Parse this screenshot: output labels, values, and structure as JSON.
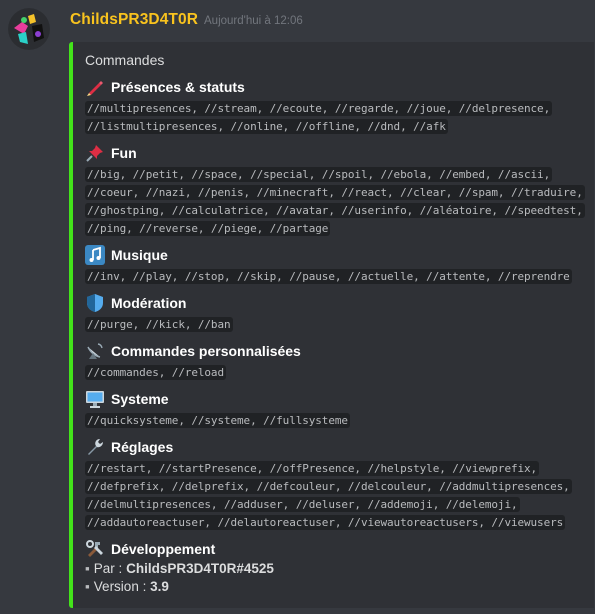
{
  "author": {
    "username": "ChildsPR3D4T0R",
    "timestamp": "Aujourd'hui à 12:06"
  },
  "embed": {
    "accent_color": "#43e31a",
    "title": "Commandes",
    "fields": [
      {
        "icon": "crayon-icon",
        "name": "Présences & statuts",
        "lines": [
          "//multipresences, //stream, //ecoute, //regarde, //joue, //delpresence,",
          "//listmultipresences, //online, //offline, //dnd, //afk"
        ]
      },
      {
        "icon": "pushpin-icon",
        "name": "Fun",
        "lines": [
          "//big, //petit, //space, //special, //spoil, //ebola, //embed, //ascii,",
          "//coeur, //nazi, //penis, //minecraft, //react, //clear, //spam, //traduire,",
          "//ghostping, //calculatrice, //avatar, //userinfo, //aléatoire, //speedtest,",
          "//ping, //reverse, //piege, //partage"
        ]
      },
      {
        "icon": "musical-notes-icon",
        "name": "Musique",
        "lines": [
          "//inv, //play, //stop, //skip, //pause, //actuelle, //attente, //reprendre"
        ]
      },
      {
        "icon": "shield-icon",
        "name": "Modération",
        "lines": [
          "//purge, //kick, //ban"
        ]
      },
      {
        "icon": "satellite-dish-icon",
        "name": "Commandes personnalisées",
        "lines": [
          "//commandes, //reload"
        ]
      },
      {
        "icon": "desktop-computer-icon",
        "name": "Systeme",
        "lines": [
          "//quicksysteme, //systeme, //fullsysteme"
        ]
      },
      {
        "icon": "wrench-icon",
        "name": "Réglages",
        "lines": [
          "//restart, //startPresence, //offPresence, //helpstyle, //viewprefix,",
          "//defprefix, //delprefix, //defcouleur, //delcouleur, //addmultipresences,",
          "//delmultipresences, //adduser, //deluser, //addemoji, //delemoji,",
          "//addautoreactuser, //delautoreactuser, //viewautoreactusers, //viewusers"
        ]
      }
    ],
    "dev": {
      "icon": "hammer-and-wrench-icon",
      "name": "Développement",
      "by_label": "Par :",
      "by_value": "ChildsPR3D4T0R#4525",
      "version_label": "Version :",
      "version_value": "3.9"
    }
  }
}
